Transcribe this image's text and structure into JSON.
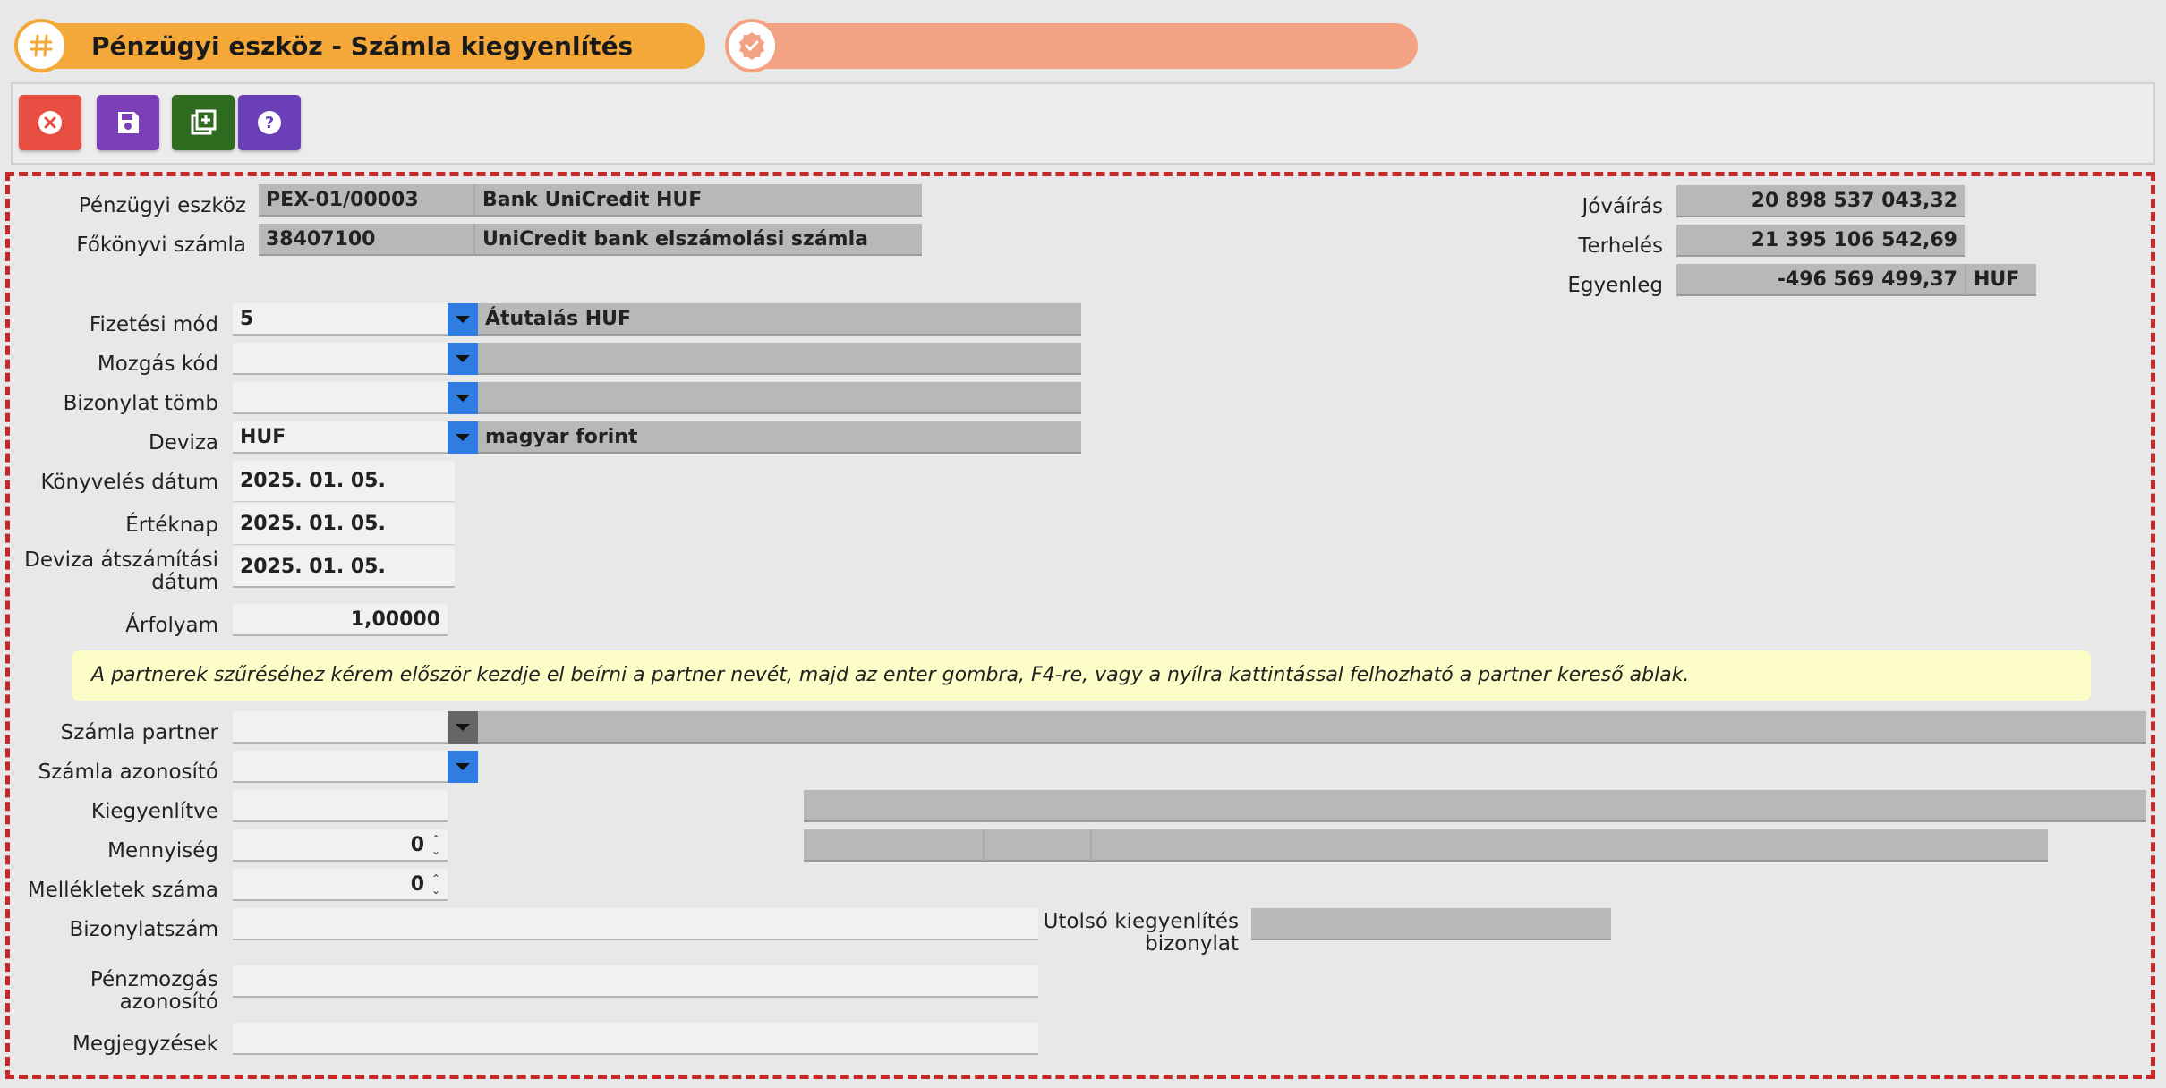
{
  "header": {
    "title": "Pénzügyi eszköz - Számla kiegyenlítés",
    "tab_color": "#f4a83a",
    "tab2_color": "#f3a383"
  },
  "toolbar": {
    "buttons": [
      {
        "name": "close",
        "icon": "close-circle-icon",
        "color": "#e84f42"
      },
      {
        "name": "save",
        "icon": "floppy-disk-icon",
        "color": "#7b3fb8"
      },
      {
        "name": "add-copy",
        "icon": "library-add-icon",
        "color": "#2e6b1e"
      },
      {
        "name": "help",
        "icon": "help-circle-icon",
        "color": "#6a3fb8"
      }
    ]
  },
  "asset": {
    "label": "Pénzügyi eszköz",
    "code": "PEX-01/00003",
    "name": "Bank UniCredit HUF"
  },
  "ledger": {
    "label": "Főkönyvi számla",
    "code": "38407100",
    "name": "UniCredit bank elszámolási számla"
  },
  "balances": {
    "credit_label": "Jóváírás",
    "credit_value": "20 898 537 043,32",
    "debit_label": "Terhelés",
    "debit_value": "21 395 106 542,69",
    "balance_label": "Egyenleg",
    "balance_value": "-496 569 499,37",
    "balance_currency": "HUF"
  },
  "form": {
    "payment_mode": {
      "label": "Fizetési mód",
      "code": "5",
      "name": "Átutalás HUF"
    },
    "movement_code": {
      "label": "Mozgás kód",
      "code": "",
      "name": ""
    },
    "voucher_block": {
      "label": "Bizonylat tömb",
      "code": "",
      "name": ""
    },
    "currency": {
      "label": "Deviza",
      "code": "HUF",
      "name": "magyar forint"
    },
    "posting_date": {
      "label": "Könyvelés dátum",
      "value": "2025. 01. 05."
    },
    "value_date": {
      "label": "Értéknap",
      "value": "2025. 01. 05."
    },
    "fx_date": {
      "label_line1": "Deviza átszámítási",
      "label_line2": "dátum",
      "value": "2025. 01. 05."
    },
    "rate": {
      "label": "Árfolyam",
      "value": "1,00000"
    },
    "info_text": "A partnerek szűréséhez kérem először kezdje el beírni a partner nevét, majd az enter gombra, F4-re, vagy a nyílra kattintással felhozható a partner kereső ablak.",
    "invoice_partner": {
      "label": "Számla partner",
      "value": ""
    },
    "invoice_id": {
      "label": "Számla azonosító",
      "value": ""
    },
    "settled": {
      "label": "Kiegyenlítve",
      "value": ""
    },
    "quantity": {
      "label": "Mennyiség",
      "value": "0"
    },
    "attachments": {
      "label": "Mellékletek száma",
      "value": "0"
    },
    "voucher_no": {
      "label": "Bizonylatszám",
      "value": ""
    },
    "last_settlement": {
      "label_line1": "Utolsó kiegyenlítés",
      "label_line2": "bizonylat",
      "value": ""
    },
    "cash_move_id": {
      "label_line1": "Pénzmozgás",
      "label_line2": "azonosító",
      "value": ""
    },
    "notes": {
      "label": "Megjegyzések",
      "value": ""
    }
  }
}
